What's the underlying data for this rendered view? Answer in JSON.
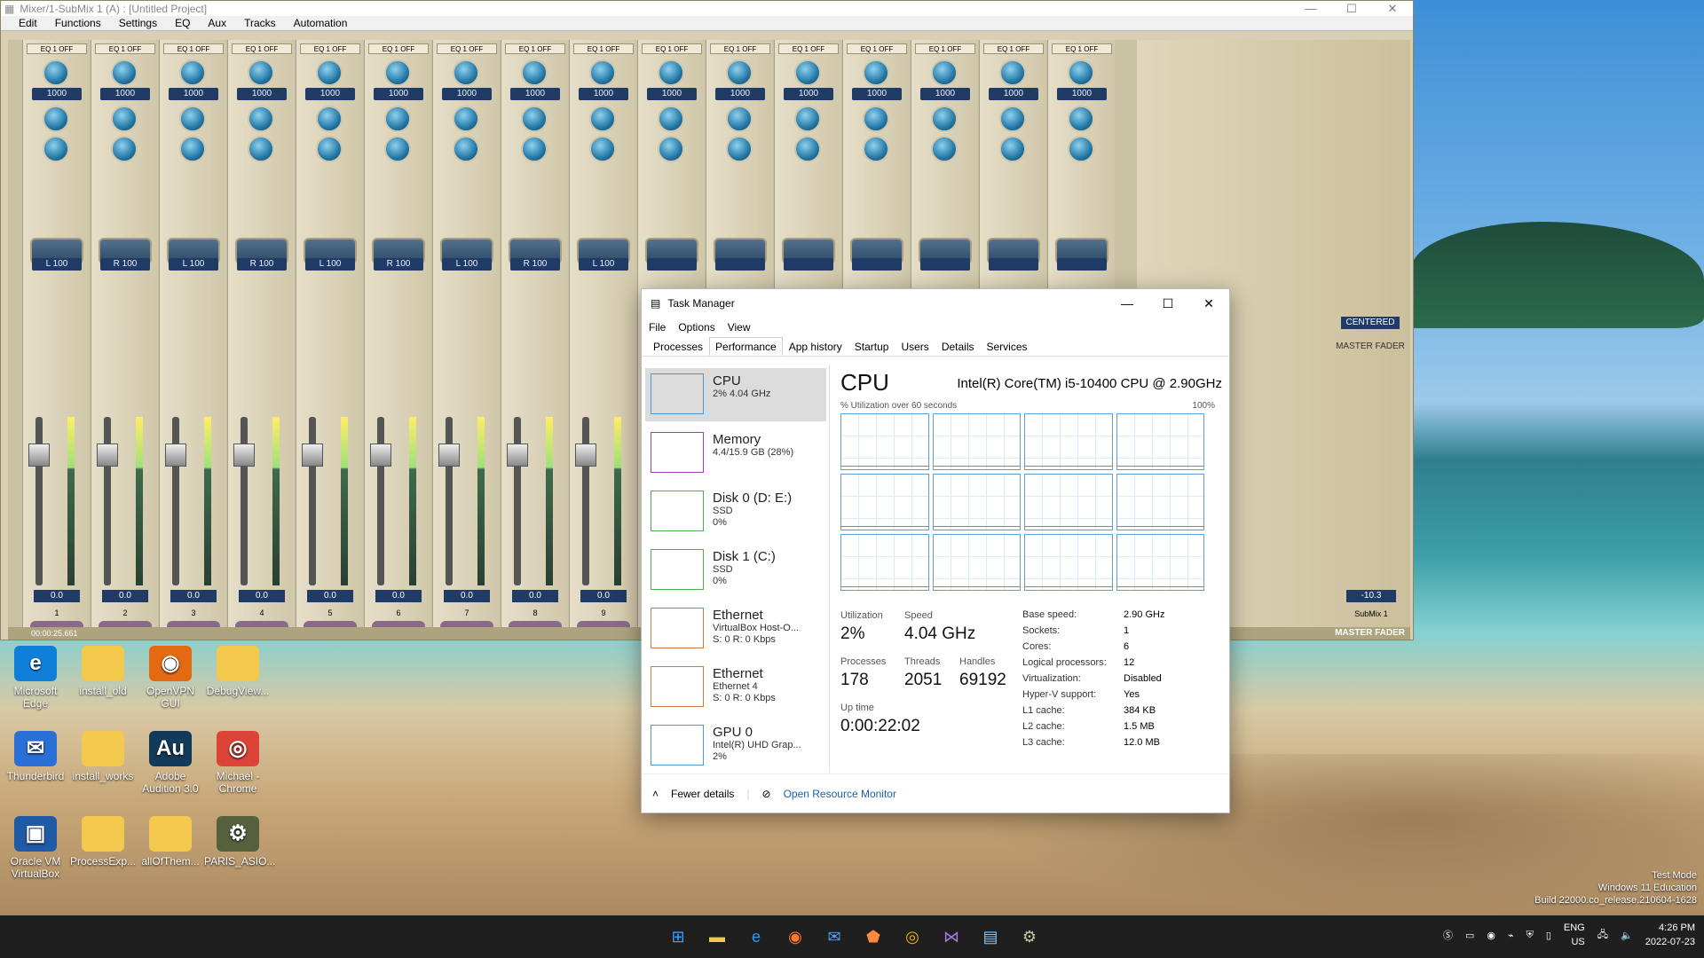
{
  "mixer": {
    "title": "Mixer/1-SubMix 1 (A) : [Untitled Project]",
    "menu": [
      "Edit",
      "Functions",
      "Settings",
      "EQ",
      "Aux",
      "Tracks",
      "Automation"
    ],
    "strips": [
      {
        "pan": "L 100",
        "num": "1"
      },
      {
        "pan": "R 100",
        "num": "2"
      },
      {
        "pan": "L 100",
        "num": "3"
      },
      {
        "pan": "R 100",
        "num": "4"
      },
      {
        "pan": "L 100",
        "num": "5"
      },
      {
        "pan": "R 100",
        "num": "6"
      },
      {
        "pan": "L 100",
        "num": "7"
      },
      {
        "pan": "R 100",
        "num": "8"
      },
      {
        "pan": "L 100",
        "num": "9"
      },
      {
        "pan": "",
        "num": ""
      },
      {
        "pan": "",
        "num": ""
      },
      {
        "pan": "",
        "num": ""
      },
      {
        "pan": "",
        "num": ""
      },
      {
        "pan": "",
        "num": ""
      },
      {
        "pan": "",
        "num": ""
      },
      {
        "pan": "",
        "num": ""
      }
    ],
    "eq_label": "EQ 1 OFF",
    "freq": "1000",
    "vol": "0.0",
    "master_label": "MASTER FADER",
    "master_vol": "-10.3",
    "submix_label": "SubMix 1",
    "centered": "CENTERED",
    "timecode": "00:00:25.661",
    "master_fader_footer": "MASTER FADER"
  },
  "desktop": {
    "icons": [
      {
        "label": "Microsoft Edge",
        "glyph": "e",
        "color": "#0f7fd9"
      },
      {
        "label": "install_old",
        "glyph": "",
        "color": "#f2c94c"
      },
      {
        "label": "OpenVPN GUI",
        "glyph": "◉",
        "color": "#e36a12"
      },
      {
        "label": "DebugView...",
        "glyph": "",
        "color": "#f2c94c"
      },
      {
        "label": "Thunderbird",
        "glyph": "✉",
        "color": "#2a6fd6"
      },
      {
        "label": "install_works",
        "glyph": "",
        "color": "#f2c94c"
      },
      {
        "label": "Adobe Audition 3.0",
        "glyph": "Au",
        "color": "#123a5a"
      },
      {
        "label": "Michael - Chrome",
        "glyph": "◎",
        "color": "#db4437"
      },
      {
        "label": "Oracle VM VirtualBox",
        "glyph": "▣",
        "color": "#1f5aa6"
      },
      {
        "label": "ProcessExp...",
        "glyph": "",
        "color": "#f2c94c"
      },
      {
        "label": "allOfThem...",
        "glyph": "",
        "color": "#f2c94c"
      },
      {
        "label": "PARIS_ASIO...",
        "glyph": "⚙",
        "color": "#55603c"
      }
    ]
  },
  "taskmanager": {
    "title": "Task Manager",
    "menu": [
      "File",
      "Options",
      "View"
    ],
    "tabs": [
      "Processes",
      "Performance",
      "App history",
      "Startup",
      "Users",
      "Details",
      "Services"
    ],
    "resources": [
      {
        "name": "CPU",
        "sub1": "2% 4.04 GHz",
        "sub2": "",
        "color": "#4a97d4"
      },
      {
        "name": "Memory",
        "sub1": "4.4/15.9 GB (28%)",
        "sub2": "",
        "color": "#9b3fb0"
      },
      {
        "name": "Disk 0 (D: E:)",
        "sub1": "SSD",
        "sub2": "0%",
        "color": "#4cae4c"
      },
      {
        "name": "Disk 1 (C:)",
        "sub1": "SSD",
        "sub2": "0%",
        "color": "#4cae4c"
      },
      {
        "name": "Ethernet",
        "sub1": "VirtualBox Host-O...",
        "sub2": "S: 0 R: 0 Kbps",
        "color": "#c9793e"
      },
      {
        "name": "Ethernet",
        "sub1": "Ethernet 4",
        "sub2": "S: 0 R: 0 Kbps",
        "color": "#c9793e"
      },
      {
        "name": "GPU 0",
        "sub1": "Intel(R) UHD Grap...",
        "sub2": "2%",
        "color": "#4a97d4"
      }
    ],
    "cpu_title": "CPU",
    "cpu_model": "Intel(R) Core(TM) i5-10400 CPU @ 2.90GHz",
    "util_label": "% Utilization over 60 seconds",
    "util_max": "100%",
    "stats": {
      "utilization_label": "Utilization",
      "utilization": "2%",
      "speed_label": "Speed",
      "speed": "4.04 GHz",
      "processes_label": "Processes",
      "processes": "178",
      "threads_label": "Threads",
      "threads": "2051",
      "handles_label": "Handles",
      "handles": "69192",
      "uptime_label": "Up time",
      "uptime": "0:00:22:02"
    },
    "details": [
      [
        "Base speed:",
        "2.90 GHz"
      ],
      [
        "Sockets:",
        "1"
      ],
      [
        "Cores:",
        "6"
      ],
      [
        "Logical processors:",
        "12"
      ],
      [
        "Virtualization:",
        "Disabled"
      ],
      [
        "Hyper-V support:",
        "Yes"
      ],
      [
        "L1 cache:",
        "384 KB"
      ],
      [
        "L2 cache:",
        "1.5 MB"
      ],
      [
        "L3 cache:",
        "12.0 MB"
      ]
    ],
    "fewer_details": "Fewer details",
    "open_monitor": "Open Resource Monitor"
  },
  "watermark": {
    "line1": "Test Mode",
    "line2": "Windows 11 Education",
    "line3": "Build 22000.co_release.210604-1628"
  },
  "taskbar": {
    "lang1": "ENG",
    "lang2": "US",
    "time": "4:26 PM",
    "date": "2022-07-23"
  }
}
